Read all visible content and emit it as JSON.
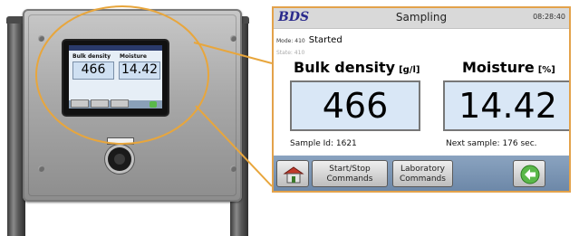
{
  "zoom": {
    "brand": "BDS",
    "title": "Sampling",
    "clock": "08:28:40",
    "mode_label": "Mode: 410",
    "mode_value": "Started",
    "state_label": "State: 410",
    "bulk": {
      "label": "Bulk density",
      "unit": "[g/l]",
      "value": "466"
    },
    "moisture": {
      "label": "Moisture",
      "unit": "[%]",
      "value": "14.42"
    },
    "sample_id": "Sample Id: 1621",
    "next_sample": "Next sample: 176 sec.",
    "buttons": {
      "home_icon": "house-icon",
      "start_stop_line1": "Start/Stop",
      "start_stop_line2": "Commands",
      "lab_line1": "Laboratory",
      "lab_line2": "Commands",
      "go_icon": "green-arrow-icon"
    }
  },
  "mini": {
    "bulk_label": "Bulk density",
    "moisture_label": "Moisture",
    "bulk_value": "466",
    "moisture_value": "14.42"
  },
  "colors": {
    "accent_circle": "#e8a63c",
    "value_box": "#d9e7f6",
    "bottom_bar": "#6d88a8",
    "brand": "#2a2a8c"
  }
}
